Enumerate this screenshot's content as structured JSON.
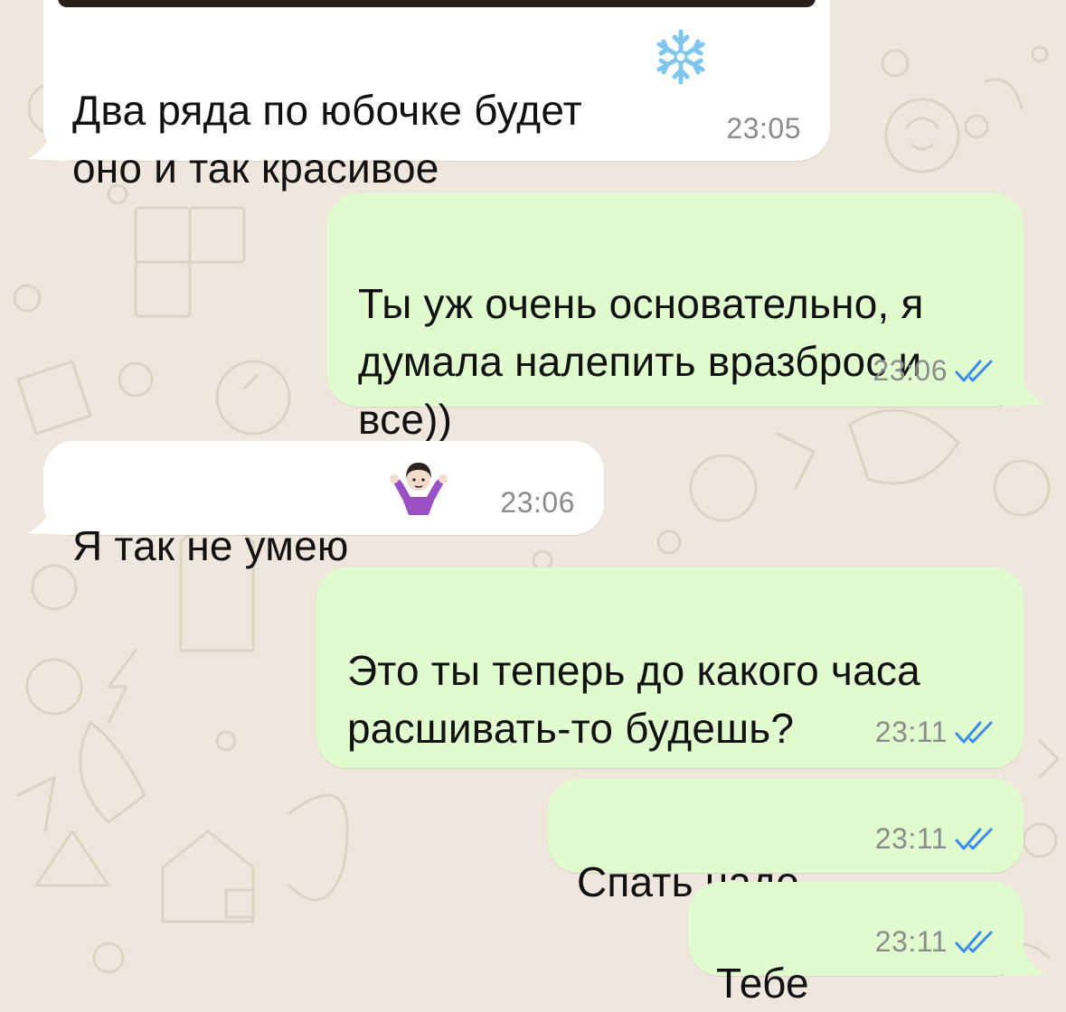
{
  "chat": {
    "messages": [
      {
        "id": "m1",
        "direction": "incoming",
        "text": "Два ряда по юбочке будет\nоно и так красивое",
        "emoji": "snowflake-icon",
        "time": "23:05"
      },
      {
        "id": "m2",
        "direction": "outgoing",
        "text": "Ты уж очень основательно, я\nдумала налепить вразброс и\nвсе))",
        "time": "23:06",
        "status": "read"
      },
      {
        "id": "m3",
        "direction": "incoming",
        "text": "Я так не умею",
        "emoji": "person-shrugging-icon",
        "time": "23:06"
      },
      {
        "id": "m4",
        "direction": "outgoing",
        "text": "Это ты теперь до какого часа\nрасшивать-то будешь?",
        "time": "23:11",
        "status": "read"
      },
      {
        "id": "m5",
        "direction": "outgoing",
        "text": "Спать надо",
        "time": "23:11",
        "status": "read"
      },
      {
        "id": "m6",
        "direction": "outgoing",
        "text": "Тебе",
        "time": "23:11",
        "status": "read"
      }
    ]
  },
  "colors": {
    "background": "#efe7dd",
    "incoming_bubble": "#ffffff",
    "outgoing_bubble": "#e0fbce",
    "read_ticks": "#3b8be8",
    "timestamp": "#8b8b8b"
  }
}
